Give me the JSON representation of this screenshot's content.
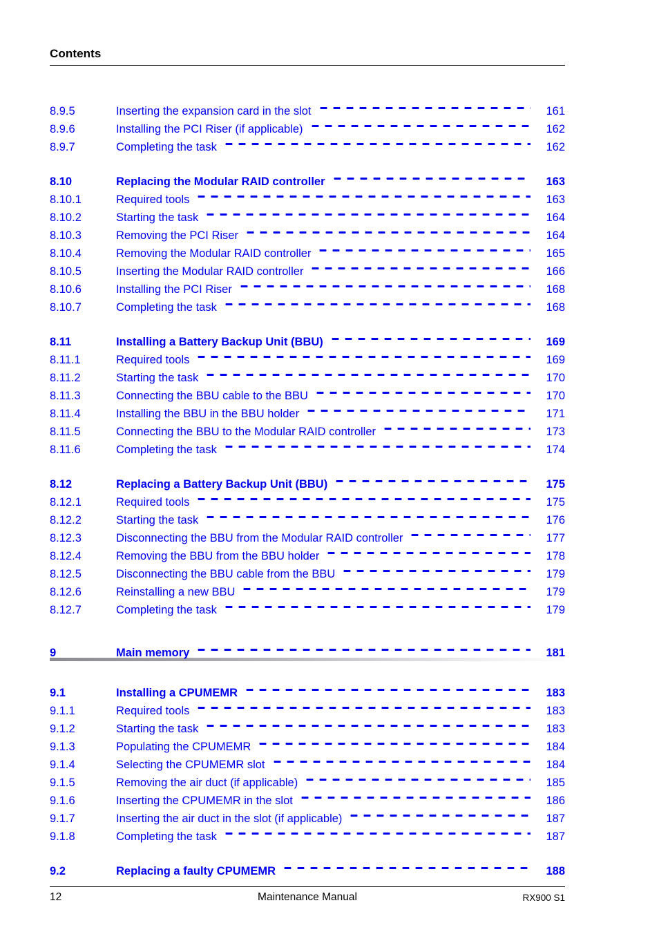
{
  "header": {
    "title": "Contents"
  },
  "colors": {
    "link_blue": "#0000ee",
    "text_black": "#000000",
    "page_background": "#ffffff",
    "rule_gradient_start": "#8a8a90",
    "rule_gradient_end": "#fdfdfd"
  },
  "toc": {
    "groups": [
      {
        "id": "group-8-9-tail",
        "gap_before": "none",
        "rows": [
          {
            "level": 2,
            "num": "8.9.5",
            "title": "Inserting the expansion card in the slot",
            "page": "161"
          },
          {
            "level": 2,
            "num": "8.9.6",
            "title": "Installing the PCI Riser (if applicable)",
            "page": "162"
          },
          {
            "level": 2,
            "num": "8.9.7",
            "title": "Completing the task",
            "page": "162"
          }
        ]
      },
      {
        "id": "group-8-10",
        "gap_before": "md",
        "rows": [
          {
            "level": 1,
            "num": "8.10",
            "title": "Replacing the Modular RAID controller",
            "page": "163"
          },
          {
            "level": 2,
            "num": "8.10.1",
            "title": "Required tools",
            "page": "163"
          },
          {
            "level": 2,
            "num": "8.10.2",
            "title": "Starting the task",
            "page": "164"
          },
          {
            "level": 2,
            "num": "8.10.3",
            "title": "Removing the PCI Riser",
            "page": "164"
          },
          {
            "level": 2,
            "num": "8.10.4",
            "title": "Removing the Modular RAID controller",
            "page": "165"
          },
          {
            "level": 2,
            "num": "8.10.5",
            "title": "Inserting the Modular RAID controller",
            "page": "166"
          },
          {
            "level": 2,
            "num": "8.10.6",
            "title": "Installing the PCI Riser",
            "page": "168"
          },
          {
            "level": 2,
            "num": "8.10.7",
            "title": "Completing the task",
            "page": "168"
          }
        ]
      },
      {
        "id": "group-8-11",
        "gap_before": "md",
        "rows": [
          {
            "level": 1,
            "num": "8.11",
            "title": "Installing a Battery Backup Unit (BBU)",
            "page": "169"
          },
          {
            "level": 2,
            "num": "8.11.1",
            "title": "Required tools",
            "page": "169"
          },
          {
            "level": 2,
            "num": "8.11.2",
            "title": "Starting the task",
            "page": "170"
          },
          {
            "level": 2,
            "num": "8.11.3",
            "title": "Connecting the BBU cable to the BBU",
            "page": "170"
          },
          {
            "level": 2,
            "num": "8.11.4",
            "title": "Installing the BBU in the BBU holder",
            "page": "171"
          },
          {
            "level": 2,
            "num": "8.11.5",
            "title": "Connecting the BBU to the Modular RAID controller",
            "page": "173"
          },
          {
            "level": 2,
            "num": "8.11.6",
            "title": "Completing the task",
            "page": "174"
          }
        ]
      },
      {
        "id": "group-8-12",
        "gap_before": "md",
        "rows": [
          {
            "level": 1,
            "num": "8.12",
            "title": "Replacing a Battery Backup Unit (BBU)",
            "page": "175"
          },
          {
            "level": 2,
            "num": "8.12.1",
            "title": "Required tools",
            "page": "175"
          },
          {
            "level": 2,
            "num": "8.12.2",
            "title": "Starting the task",
            "page": "176"
          },
          {
            "level": 2,
            "num": "8.12.3",
            "title": "Disconnecting the BBU from the Modular RAID controller",
            "page": "177"
          },
          {
            "level": 2,
            "num": "8.12.4",
            "title": "Removing the BBU from the BBU holder",
            "page": "178"
          },
          {
            "level": 2,
            "num": "8.12.5",
            "title": "Disconnecting the BBU cable from the BBU",
            "page": "179"
          },
          {
            "level": 2,
            "num": "8.12.6",
            "title": "Reinstalling a new BBU",
            "page": "179"
          },
          {
            "level": 2,
            "num": "8.12.7",
            "title": "Completing the task",
            "page": "179"
          }
        ]
      },
      {
        "id": "group-9-chapter",
        "gap_before": "lg",
        "rows": [
          {
            "level": 0,
            "num": "9",
            "title": "Main memory",
            "page": "181"
          }
        ],
        "rule_after": "gradient"
      },
      {
        "id": "group-9-1",
        "gap_before": "md",
        "rows": [
          {
            "level": 1,
            "num": "9.1",
            "title": "Installing a CPUMEMR",
            "page": "183"
          },
          {
            "level": 2,
            "num": "9.1.1",
            "title": "Required tools",
            "page": "183"
          },
          {
            "level": 2,
            "num": "9.1.2",
            "title": "Starting the task",
            "page": "183"
          },
          {
            "level": 2,
            "num": "9.1.3",
            "title": "Populating the CPUMEMR",
            "page": "184"
          },
          {
            "level": 2,
            "num": "9.1.4",
            "title": "Selecting the CPUMEMR slot",
            "page": "184"
          },
          {
            "level": 2,
            "num": "9.1.5",
            "title": "Removing the air duct (if applicable)",
            "page": "185"
          },
          {
            "level": 2,
            "num": "9.1.6",
            "title": "Inserting the CPUMEMR in the slot",
            "page": "186"
          },
          {
            "level": 2,
            "num": "9.1.7",
            "title": "Inserting the air duct in the slot (if applicable)",
            "page": "187"
          },
          {
            "level": 2,
            "num": "9.1.8",
            "title": "Completing the task",
            "page": "187"
          }
        ]
      },
      {
        "id": "group-9-2",
        "gap_before": "md",
        "rows": [
          {
            "level": 1,
            "num": "9.2",
            "title": "Replacing a faulty CPUMEMR",
            "page": "188"
          }
        ]
      }
    ]
  },
  "footer": {
    "page_number": "12",
    "document_title": "Maintenance Manual",
    "product_name": "RX900 S1"
  }
}
